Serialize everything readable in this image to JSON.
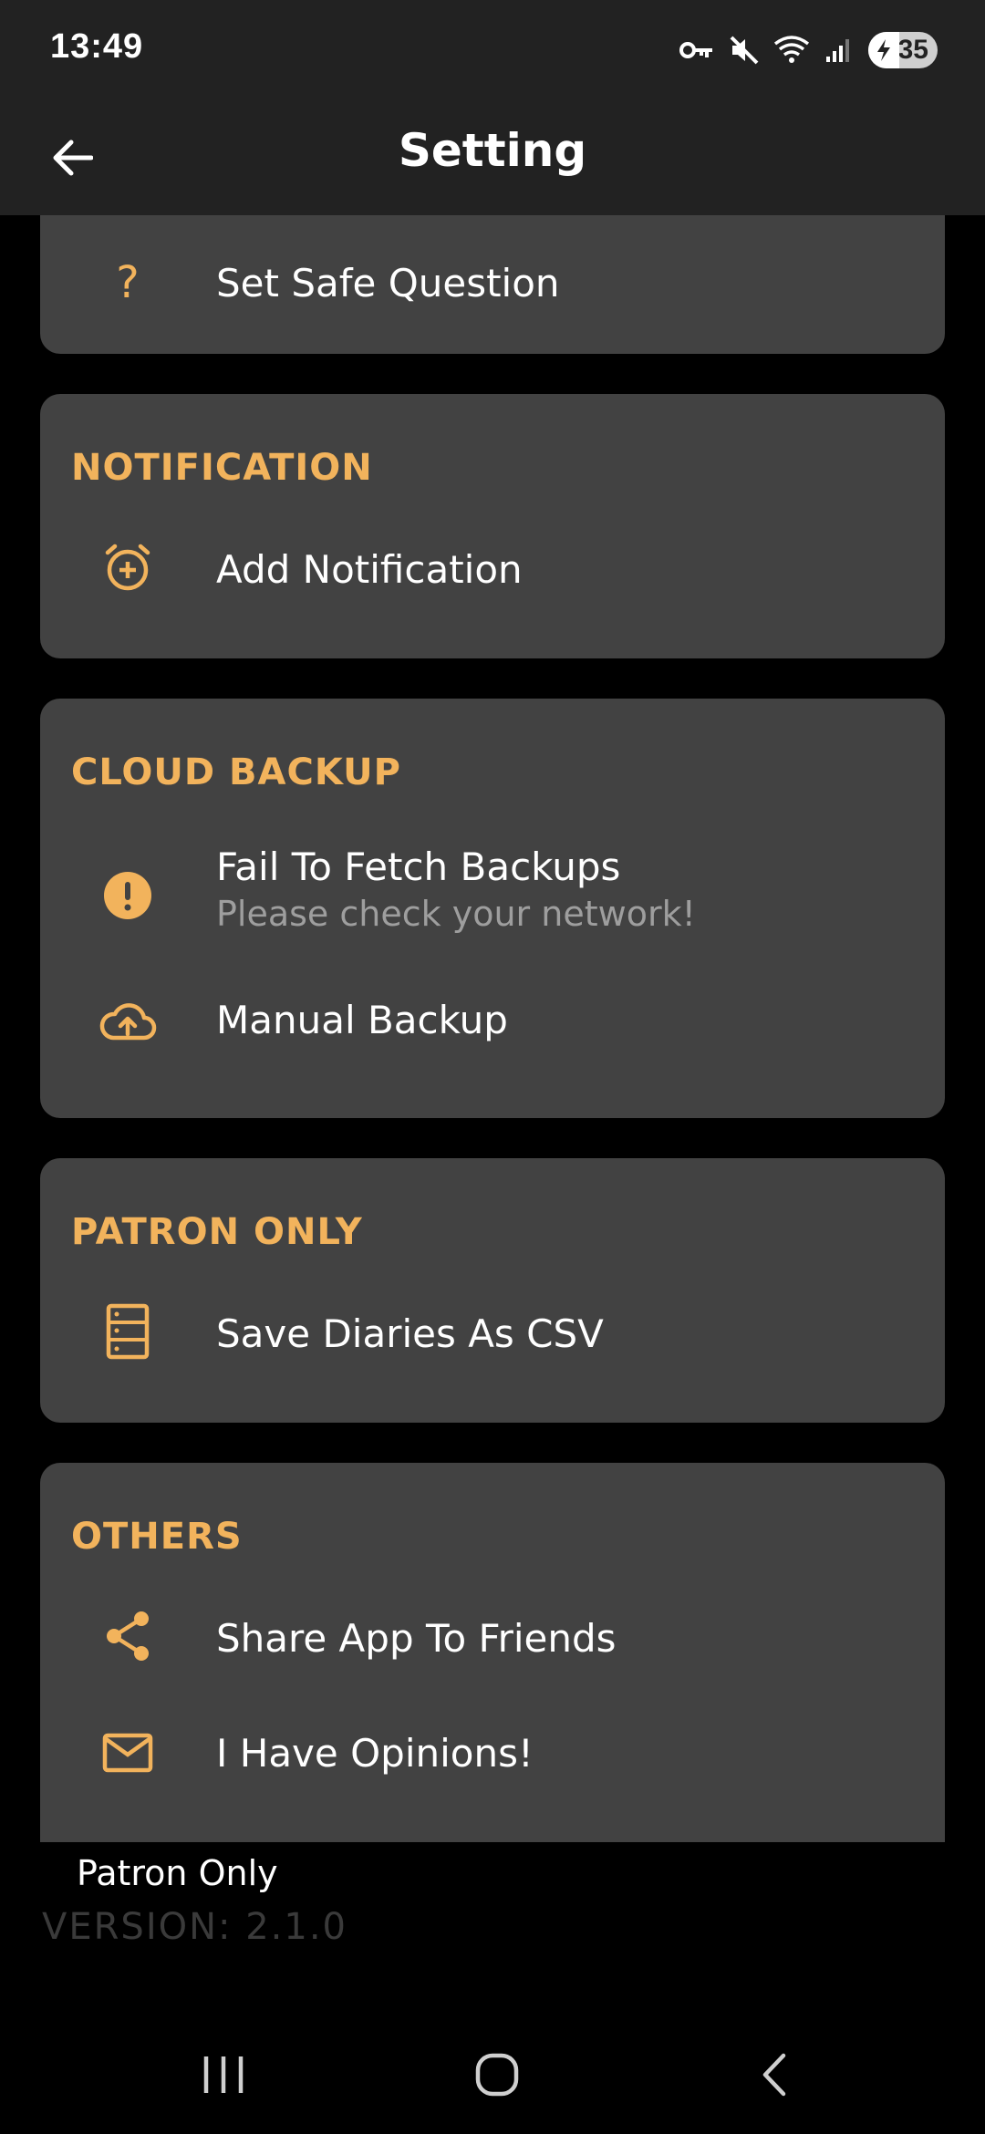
{
  "status_bar": {
    "time": "13:49",
    "battery": "35",
    "icons": [
      "vpn-key-icon",
      "mute-icon",
      "wifi-icon",
      "signal-icon",
      "battery-charging-icon"
    ]
  },
  "app_bar": {
    "title": "Setting",
    "back_icon": "arrow-left-icon"
  },
  "sections": {
    "security": {
      "items": [
        {
          "label": "Set Safe Question",
          "icon": "question-icon"
        }
      ]
    },
    "notification": {
      "title": "NOTIFICATION",
      "items": [
        {
          "label": "Add Notification",
          "icon": "alarm-add-icon"
        }
      ]
    },
    "cloud_backup": {
      "title": "CLOUD BACKUP",
      "items": [
        {
          "label": "Fail To Fetch Backups",
          "sub": "Please check your network!",
          "icon": "error-icon"
        },
        {
          "label": "Manual Backup",
          "icon": "cloud-upload-icon"
        }
      ]
    },
    "patron_only": {
      "title": "PATRON ONLY",
      "items": [
        {
          "label": "Save Diaries As CSV",
          "icon": "file-table-icon"
        }
      ]
    },
    "others": {
      "title": "OTHERS",
      "items": [
        {
          "label": "Share App To Friends",
          "icon": "share-icon"
        },
        {
          "label": "I Have Opinions!",
          "icon": "mail-icon"
        }
      ]
    }
  },
  "snackbar": {
    "text": "Patron Only"
  },
  "version": "VERSION: 2.1.0",
  "colors": {
    "accent": "#F2B35C",
    "card": "#424242",
    "bar": "#222222",
    "background": "#000000"
  },
  "nav": [
    "recents-icon",
    "home-icon",
    "back-icon"
  ]
}
